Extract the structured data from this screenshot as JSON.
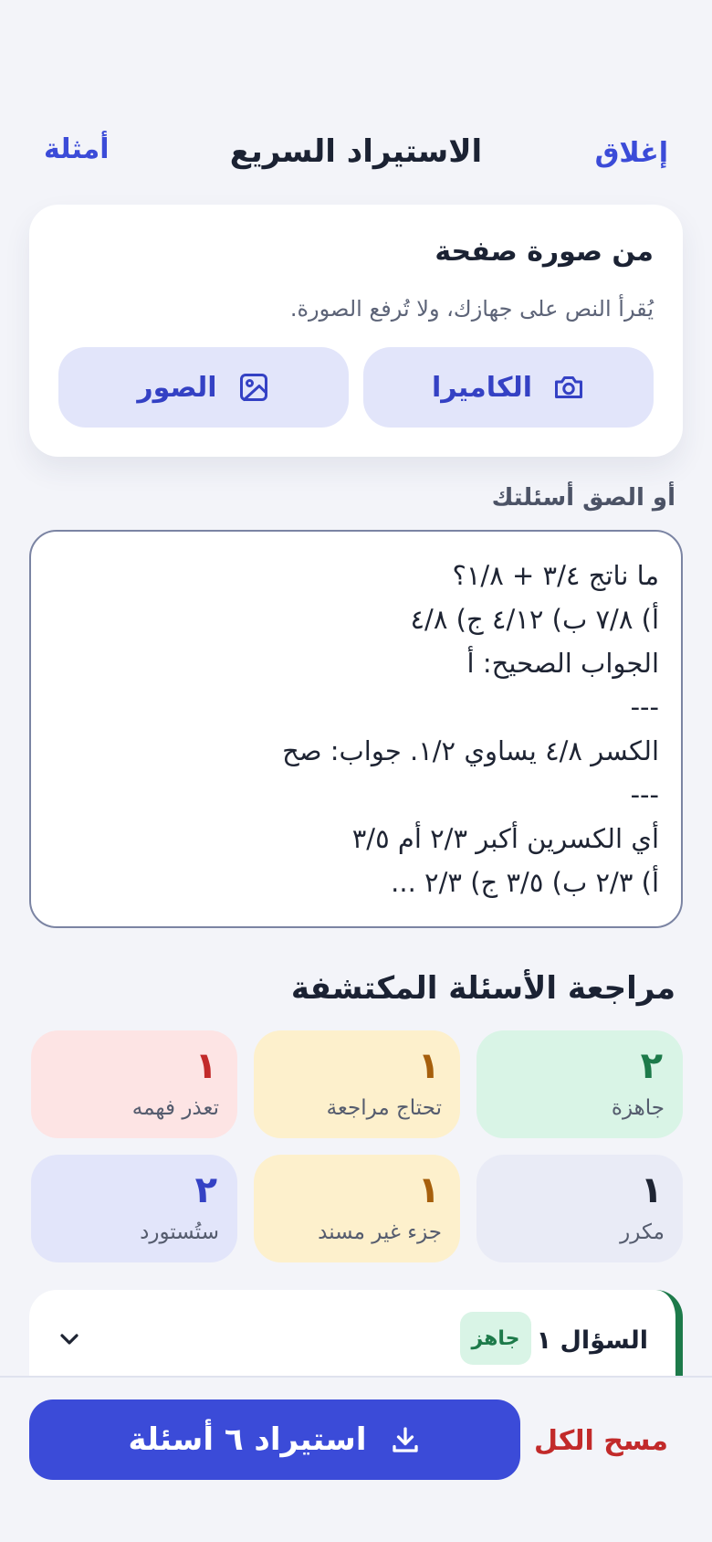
{
  "header": {
    "close_label": "إغلاق",
    "title": "الاستيراد السريع",
    "examples_label": "أمثلة"
  },
  "photo_card": {
    "title": "من صورة صفحة",
    "subtitle": "يُقرأ النص على جهازك، ولا تُرفع الصورة.",
    "camera_label": "الكاميرا",
    "camera_icon": "camera-icon",
    "photos_label": "الصور",
    "photos_icon": "image-icon"
  },
  "paste": {
    "label": "أو الصق أسئلتك",
    "lines": [
      "ما ناتج ٣/٤ + ١/٨؟",
      "أ) ٧/٨ ب) ٤/١٢ ج) ٤/٨",
      "الجواب الصحيح: أ",
      "---",
      "الكسر ٤/٨ يساوي ١/٢. جواب: صح",
      "---",
      "أي الكسرين أكبر ٢/٣ أم ٣/٥",
      "أ) ٢/٣ ب) ٣/٥ ج) ٢/٣ ..."
    ]
  },
  "review": {
    "title": "مراجعة الأسئلة المكتشفة",
    "stats": [
      {
        "count": "٢",
        "label": "جاهزة"
      },
      {
        "count": "١",
        "label": "تحتاج مراجعة"
      },
      {
        "count": "١",
        "label": "تعذر فهمه"
      },
      {
        "count": "١",
        "label": "مكرر"
      },
      {
        "count": "١",
        "label": "جزء غير مسند"
      },
      {
        "count": "٢",
        "label": "ستُستورد"
      }
    ],
    "colors": {
      "ready": "#1d7a4a",
      "needs_review": "#a65f0c",
      "failed": "#c22a2a",
      "to_import": "#3441c4"
    }
  },
  "question": {
    "title": "السؤال ١",
    "badge": "جاهز",
    "icon": "chevron-down-icon"
  },
  "footer": {
    "clear_all_label": "مسح الكل",
    "import_label": "استيراد ٦ أسئلة",
    "import_icon": "download-icon"
  },
  "accent": "#3b4bd8"
}
